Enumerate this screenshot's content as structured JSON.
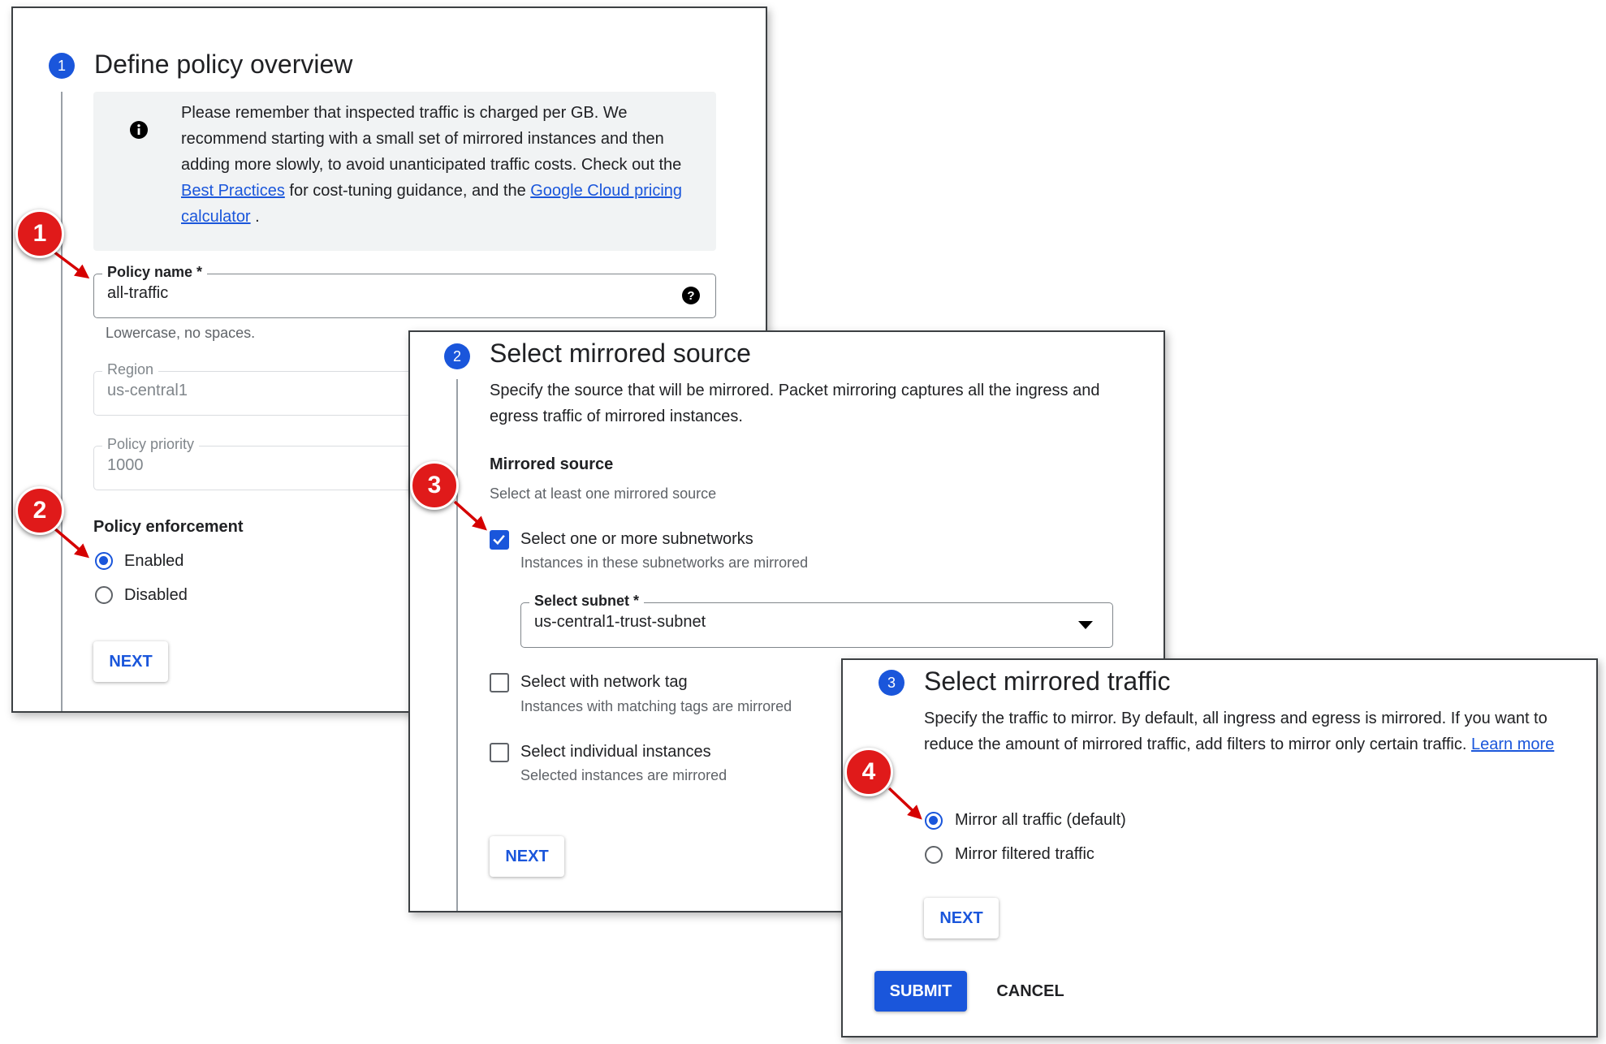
{
  "panel1": {
    "step_number": "1",
    "title": "Define policy overview",
    "info": {
      "text_before_link1": "Please remember that inspected traffic is charged per GB. We recommend starting with a small set of mirrored instances and then adding more slowly, to avoid unanticipated traffic costs. Check out the ",
      "link1": "Best Practices",
      "text_between": " for cost-tuning guidance, and the ",
      "link2": "Google Cloud pricing calculator",
      "text_after": " ."
    },
    "policy_name": {
      "label": "Policy name  *",
      "value": "all-traffic",
      "hint": "Lowercase, no spaces."
    },
    "region": {
      "label": "Region",
      "value": "us-central1"
    },
    "priority": {
      "label": "Policy priority",
      "value": "1000"
    },
    "enforcement": {
      "heading": "Policy enforcement",
      "options": [
        "Enabled",
        "Disabled"
      ],
      "selected": "Enabled"
    },
    "next_label": "NEXT"
  },
  "panel2": {
    "step_number": "2",
    "title": "Select mirrored source",
    "description": "Specify the source that will be mirrored. Packet mirroring captures all the ingress and egress traffic of mirrored instances.",
    "source_heading": "Mirrored source",
    "source_subheading": "Select at least one mirrored source",
    "options": [
      {
        "label": "Select one or more subnetworks",
        "help": "Instances in these subnetworks are mirrored",
        "checked": true
      },
      {
        "label": "Select with network tag",
        "help": "Instances with matching tags are mirrored",
        "checked": false
      },
      {
        "label": "Select individual instances",
        "help": "Selected instances are mirrored",
        "checked": false
      }
    ],
    "subnet": {
      "label": "Select subnet *",
      "value": "us-central1-trust-subnet"
    },
    "next_label": "NEXT"
  },
  "panel3": {
    "step_number": "3",
    "title": "Select mirrored traffic",
    "description": "Specify the traffic to mirror. By default, all ingress and egress is mirrored. If you want to reduce the amount of mirrored traffic, add filters to mirror only certain traffic. ",
    "learn_more": "Learn more",
    "options": [
      "Mirror all traffic (default)",
      "Mirror filtered traffic"
    ],
    "selected": "Mirror all traffic (default)",
    "next_label": "NEXT",
    "submit_label": "SUBMIT",
    "cancel_label": "CANCEL"
  },
  "callouts": [
    "1",
    "2",
    "3",
    "4"
  ],
  "colors": {
    "accent": "#1a56db",
    "callout": "#e01a1a"
  },
  "icons": {
    "info": "info-icon",
    "help": "help-circle-icon",
    "dropdown": "dropdown-arrow-icon",
    "check": "checkmark-icon"
  }
}
